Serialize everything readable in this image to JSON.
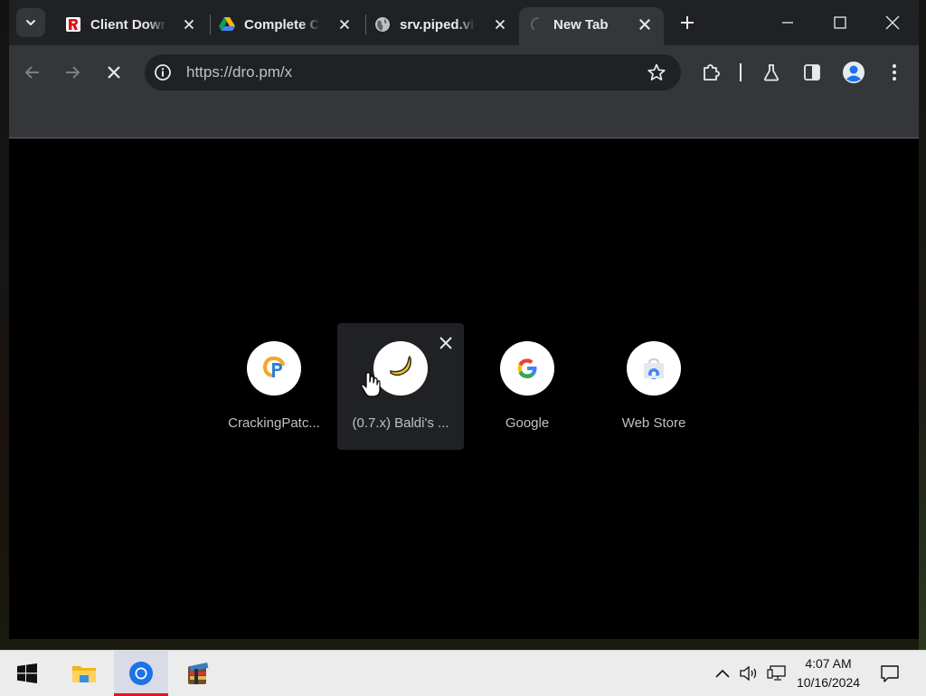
{
  "window": {
    "tabs": [
      {
        "title": "Client Downloads",
        "favicon": "r-logo-icon",
        "active": false
      },
      {
        "title": "Complete Client",
        "favicon": "google-drive-icon",
        "active": false
      },
      {
        "title": "srv.piped.video",
        "favicon": "globe-icon",
        "active": false
      },
      {
        "title": "New Tab",
        "favicon": "loading-spinner-icon",
        "active": true
      }
    ],
    "new_tab_button": "new-tab-plus-icon",
    "controls": [
      "minimize-icon",
      "maximize-icon",
      "close-window-icon"
    ]
  },
  "toolbar": {
    "back": "back-arrow-icon",
    "forward": "forward-arrow-icon",
    "stop": "stop-loading-icon",
    "url": "https://dro.pm/x",
    "site_info": "site-info-icon",
    "bookmark": "bookmark-star-icon",
    "extensions": "puzzle-extensions-icon",
    "labs": "flask-labs-icon",
    "side_panel": "side-panel-icon",
    "profile": "profile-avatar-icon",
    "menu": "kebab-menu-icon"
  },
  "new_tab_page": {
    "shortcuts": [
      {
        "label": "CrackingPatc...",
        "icon": "crackingpatching-icon"
      },
      {
        "label": "(0.7.x) Baldi's ...",
        "icon": "banana-icon",
        "hovered": true
      },
      {
        "label": "Google",
        "icon": "google-g-icon"
      },
      {
        "label": "Web Store",
        "icon": "chrome-web-store-icon"
      }
    ]
  },
  "taskbar": {
    "apps": [
      "windows-start-icon",
      "file-explorer-icon",
      "chrome-icon",
      "archive-app-icon"
    ],
    "active_app": "chrome-icon",
    "tray": [
      "show-hidden-icons-chevron",
      "volume-icon",
      "network-icon",
      "notifications-icon"
    ],
    "time": "4:07 AM",
    "date": "10/16/2024"
  },
  "colors": {
    "tabstrip": "#202124",
    "toolbar": "#35363a",
    "omnibox": "#202124",
    "taskbar": "#ececec",
    "active_taskbar_indicator": "#e81123"
  }
}
